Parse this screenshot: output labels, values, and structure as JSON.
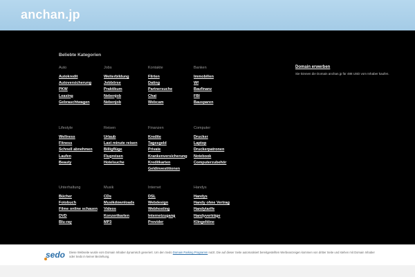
{
  "header": {
    "domain": "anchan.jp"
  },
  "popular_title": "Beliebte Kategorien",
  "categories": [
    {
      "title": "Auto",
      "links": [
        "Autokredit",
        "Autoversicherung",
        "PKW",
        "Leasing",
        "Gebrauchtwagen"
      ]
    },
    {
      "title": "Jobs",
      "links": [
        "Weiterbildung",
        "Jobbörse",
        "Praktikum",
        "Nebenjob",
        "Nebenjob"
      ]
    },
    {
      "title": "Kontakte",
      "links": [
        "Flirten",
        "Dating",
        "Partnersuche",
        "Chat",
        "Webcam"
      ]
    },
    {
      "title": "Banken",
      "links": [
        "Immobilien",
        "Wf",
        "Baufinanz",
        "FBI",
        "Bausparen"
      ]
    },
    {
      "title": "Lifestyle",
      "links": [
        "Wellness",
        "Fitness",
        "Schnell abnehmen",
        "Laufen",
        "Beauty"
      ]
    },
    {
      "title": "Reisen",
      "links": [
        "Urlaub",
        "Last minute reisen",
        "Billigflüge",
        "Flugreisen",
        "Hotelsuche"
      ]
    },
    {
      "title": "Finanzen",
      "links": [
        "Kredite",
        "Tagesgeld",
        "Private",
        "Krankenversicherung",
        "Kreditkarten",
        "Geldinvestitionen"
      ]
    },
    {
      "title": "Computer",
      "links": [
        "Drucker",
        "Laptop",
        "Druckerpatronen",
        "Notebook",
        "Computerzubehör"
      ]
    },
    {
      "title": "Unterhaltung",
      "links": [
        "Bücher",
        "Fotobuch",
        "Filme online schauen",
        "DVD",
        "Blu-ray"
      ]
    },
    {
      "title": "Musik",
      "links": [
        "CDs",
        "Musikdownloads",
        "Videos",
        "Konzertkarten",
        "MP3"
      ]
    },
    {
      "title": "Internet",
      "links": [
        "DSL",
        "Webdesign",
        "Webhosting",
        "Internetzugang",
        "Provider"
      ]
    },
    {
      "title": "Handys",
      "links": [
        "Handys",
        "Handy ohne Vertrag",
        "Handytarife",
        "Handyverträge",
        "Klingeltöne"
      ]
    }
  ],
  "offer": {
    "title": "Domain erwerben",
    "text": "Sie können die Domain anchan.jp für 488 USD vom Inhaber kaufen."
  },
  "footer": {
    "logo": "sedo",
    "text_before": "Diese Webseite wurde vom Domain Inhaber dynamisch generiert. Um den Sedo ",
    "link": "Domain Parking Programm",
    "text_after": " nutzt. Die auf dieser Seite automatisiert bereitgestellten Werbeanzeigen kommen von dritter Seite und stehen mit Domain Inhaber oder Sedo in keiner Beziehung.",
    "colors": {
      "logo_blue": "#2a6ea8",
      "logo_orange": "#e08a1e"
    }
  }
}
